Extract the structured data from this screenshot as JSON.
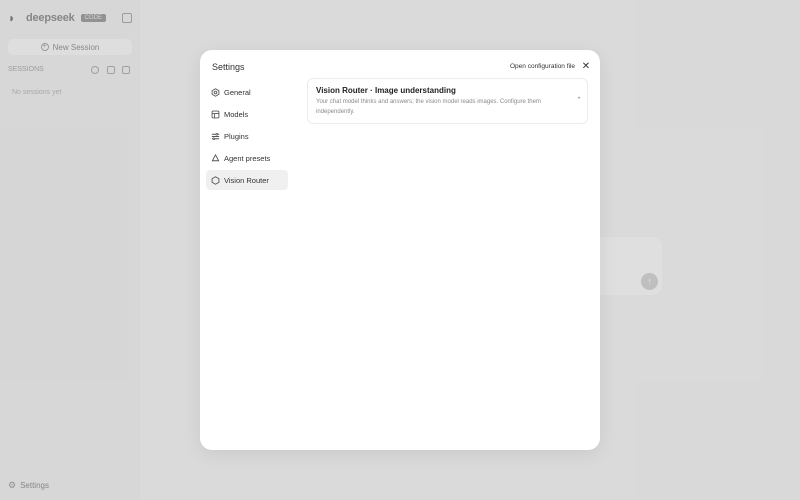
{
  "sidebar": {
    "brand_name": "deepseek",
    "brand_badge": "CODE",
    "new_session_label": "New Session",
    "section_label": "SESSIONS",
    "empty_text": "No sessions yet",
    "settings_label": "Settings"
  },
  "modal": {
    "title": "Settings",
    "open_config_label": "Open configuration file",
    "nav": [
      {
        "label": "General",
        "icon": "gear-icon"
      },
      {
        "label": "Models",
        "icon": "cube-icon"
      },
      {
        "label": "Plugins",
        "icon": "sliders-icon"
      },
      {
        "label": "Agent presets",
        "icon": "recycle-icon"
      },
      {
        "label": "Vision Router",
        "icon": "hexagon-icon",
        "active": true
      }
    ],
    "card": {
      "title": "Vision Router · Image understanding",
      "description": "Your chat model thinks and answers; the vision model reads images. Configure them independently."
    }
  }
}
